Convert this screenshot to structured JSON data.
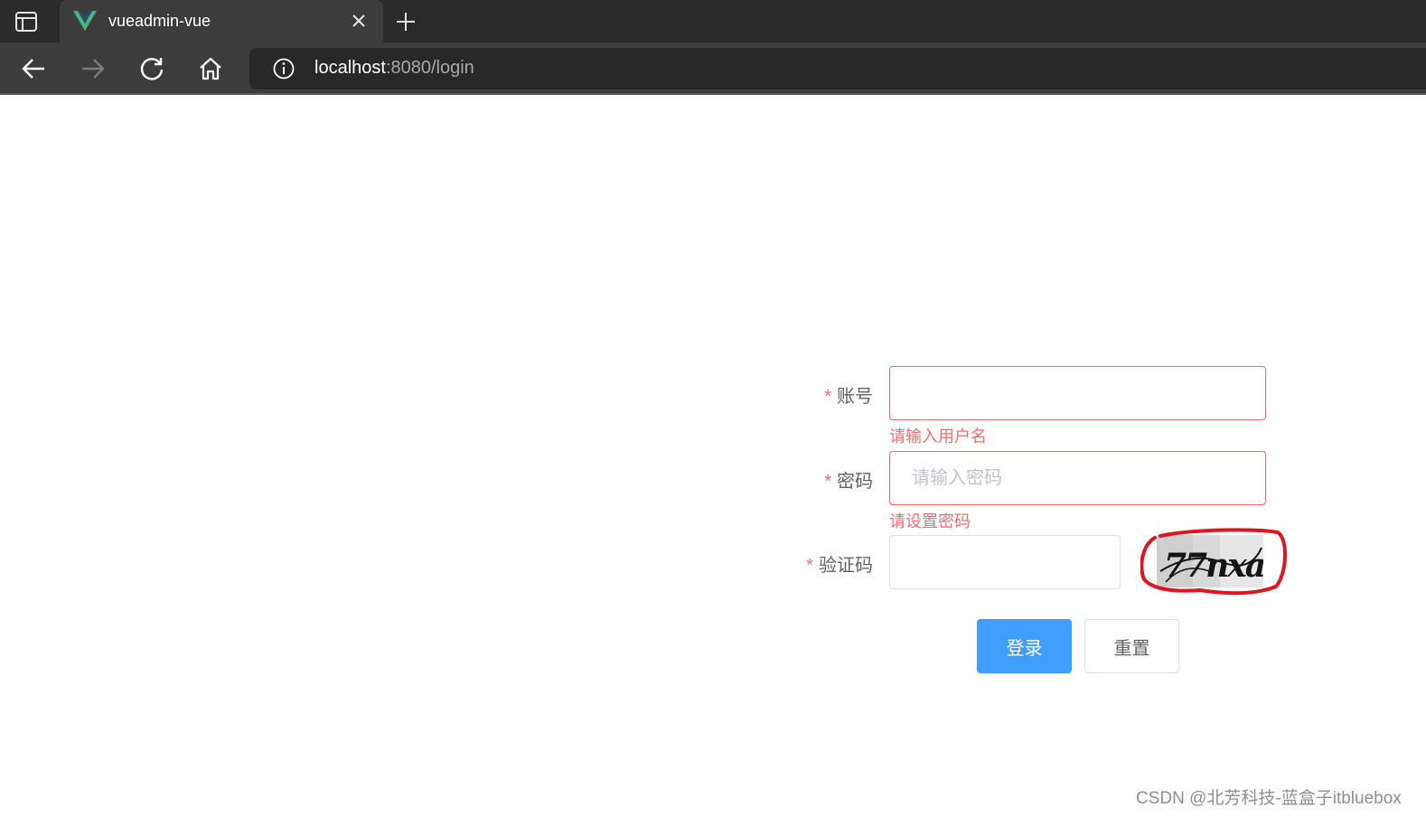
{
  "browser": {
    "tab_title": "vueadmin-vue",
    "address_host": "localhost",
    "address_rest": ":8080/login"
  },
  "form": {
    "username": {
      "label": "账号",
      "value": "",
      "placeholder": "",
      "error": "请输入用户名"
    },
    "password": {
      "label": "密码",
      "value": "",
      "placeholder": "请输入密码",
      "error": "请设置密码"
    },
    "captcha": {
      "label": "验证码",
      "value": "",
      "placeholder": "",
      "image_text": "77nxa"
    },
    "required_mark": "*",
    "login_label": "登录",
    "reset_label": "重置"
  },
  "watermark": "CSDN @北芳科技-蓝盒子itbluebox",
  "colors": {
    "primary": "#409eff",
    "error": "#f56c6c",
    "label": "#606266",
    "annotation": "#e0141e"
  }
}
